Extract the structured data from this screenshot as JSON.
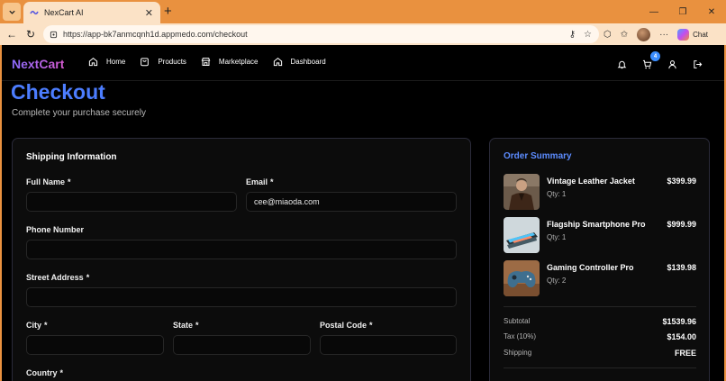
{
  "browser": {
    "tab_title": "NexCart AI",
    "url": "https://app-bk7anmcqnh1d.appmedo.com/checkout",
    "chat_label": "Chat"
  },
  "app": {
    "logo": "NextCart",
    "nav": [
      {
        "label": "Home",
        "icon": "home-icon"
      },
      {
        "label": "Products",
        "icon": "bag-icon"
      },
      {
        "label": "Marketplace",
        "icon": "store-icon"
      },
      {
        "label": "Dashboard",
        "icon": "home-icon"
      }
    ],
    "cart_count": "4"
  },
  "page": {
    "title": "Checkout",
    "subtitle": "Complete your purchase securely"
  },
  "shipping": {
    "title": "Shipping Information",
    "required_mark": "*",
    "full_name_label": "Full Name",
    "full_name_value": "",
    "email_label": "Email",
    "email_value": "cee@miaoda.com",
    "phone_label": "Phone Number",
    "phone_value": "",
    "street_label": "Street Address",
    "street_value": "",
    "city_label": "City",
    "city_value": "",
    "state_label": "State",
    "state_value": "",
    "postal_label": "Postal Code",
    "postal_value": "",
    "country_label": "Country"
  },
  "summary": {
    "title": "Order Summary",
    "items": [
      {
        "name": "Vintage Leather Jacket",
        "qty": "Qty: 1",
        "price": "$399.99"
      },
      {
        "name": "Flagship Smartphone Pro",
        "qty": "Qty: 1",
        "price": "$999.99"
      },
      {
        "name": "Gaming Controller Pro",
        "qty": "Qty: 2",
        "price": "$139.98"
      }
    ],
    "subtotal_label": "Subtotal",
    "subtotal_value": "$1539.96",
    "tax_label": "Tax (10%)",
    "tax_value": "$154.00",
    "shipping_label": "Shipping",
    "shipping_value": "FREE"
  },
  "colors": {
    "accent": "#4c7dff",
    "browser_frame": "#e9913f",
    "badge": "#3a8dff"
  }
}
